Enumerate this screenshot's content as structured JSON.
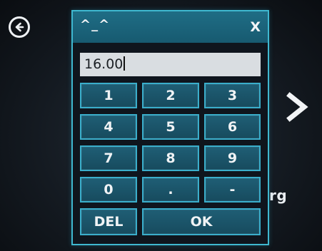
{
  "dialog": {
    "title": "^_^",
    "close_label": "X",
    "input_value": "16.00"
  },
  "keypad": {
    "keys": [
      "1",
      "2",
      "3",
      "4",
      "5",
      "6",
      "7",
      "8",
      "9",
      "0",
      ".",
      "-"
    ],
    "delete_label": "DEL",
    "ok_label": "OK"
  },
  "background": {
    "partial_label": "rg"
  },
  "icons": {
    "back": "back-arrow-circle-icon",
    "next": "chevron-right-icon"
  },
  "colors": {
    "accent_border": "#3fb8d0",
    "key_fill": "#1f5e75",
    "titlebar_fill": "#1f6d85",
    "input_fill": "#d9dde1"
  }
}
